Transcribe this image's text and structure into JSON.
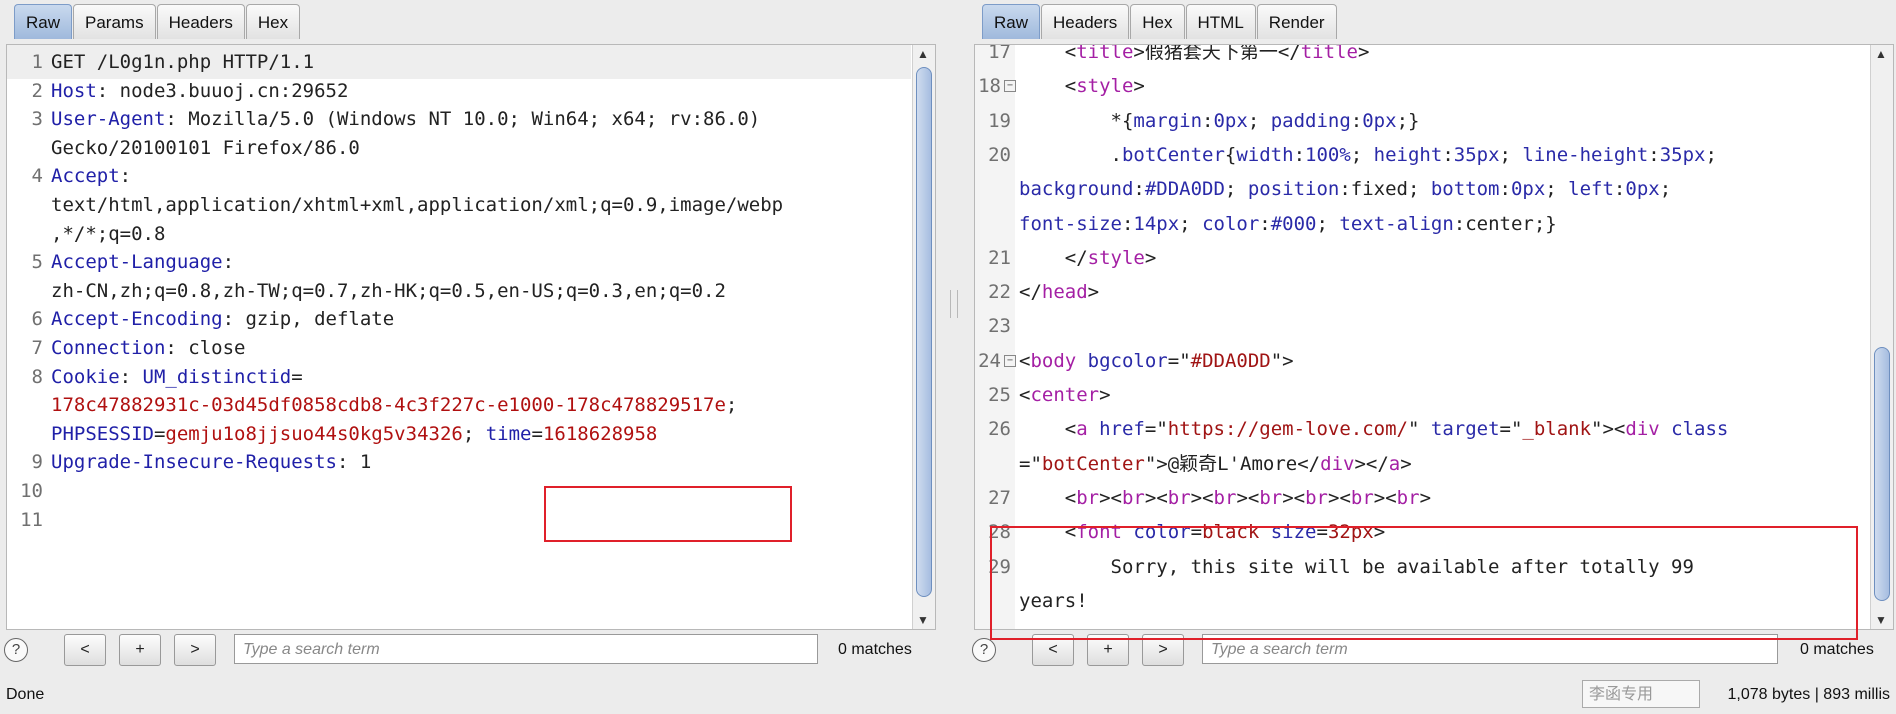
{
  "left": {
    "tabs": [
      "Raw",
      "Params",
      "Headers",
      "Hex"
    ],
    "active_tab": "Raw",
    "search_placeholder": "Type a search term",
    "matches": "0 matches"
  },
  "right": {
    "tabs": [
      "Raw",
      "Headers",
      "Hex",
      "HTML",
      "Render"
    ],
    "active_tab": "Raw",
    "search_placeholder": "Type a search term",
    "matches": "0 matches"
  },
  "nav_labels": {
    "prev": "<",
    "plus": "+",
    "next": ">",
    "help": "?"
  },
  "status": {
    "left": "Done",
    "right": "1,078 bytes | 893 millis",
    "ime": "李函专用"
  },
  "colors": {
    "highlight_box": "#e0202a",
    "active_tab": "#a9c1e2"
  },
  "request_lines": [
    {
      "n": "1",
      "segs": [
        [
          "p",
          "GET /L0g1n.php HTTP/1.1"
        ]
      ]
    },
    {
      "n": "2",
      "segs": [
        [
          "k",
          "Host"
        ],
        [
          "p",
          ": node3.buuoj.cn:29652"
        ]
      ]
    },
    {
      "n": "3",
      "segs": [
        [
          "k",
          "User-Agent"
        ],
        [
          "p",
          ": Mozilla/5.0 (Windows NT 10.0; Win64; x64; rv:86.0)"
        ]
      ]
    },
    {
      "n": "",
      "segs": [
        [
          "p",
          "Gecko/20100101 Firefox/86.0"
        ]
      ]
    },
    {
      "n": "4",
      "segs": [
        [
          "k",
          "Accept"
        ],
        [
          "p",
          ":"
        ]
      ]
    },
    {
      "n": "",
      "segs": [
        [
          "p",
          "text/html,application/xhtml+xml,application/xml;q=0.9,image/webp"
        ]
      ]
    },
    {
      "n": "",
      "segs": [
        [
          "p",
          ",*/*;q=0.8"
        ]
      ]
    },
    {
      "n": "5",
      "segs": [
        [
          "k",
          "Accept-Language"
        ],
        [
          "p",
          ":"
        ]
      ]
    },
    {
      "n": "",
      "segs": [
        [
          "p",
          "zh-CN,zh;q=0.8,zh-TW;q=0.7,zh-HK;q=0.5,en-US;q=0.3,en;q=0.2"
        ]
      ]
    },
    {
      "n": "6",
      "segs": [
        [
          "k",
          "Accept-Encoding"
        ],
        [
          "p",
          ": gzip, deflate"
        ]
      ]
    },
    {
      "n": "7",
      "segs": [
        [
          "k",
          "Connection"
        ],
        [
          "p",
          ": close"
        ]
      ]
    },
    {
      "n": "8",
      "segs": [
        [
          "k",
          "Cookie"
        ],
        [
          "p",
          ": "
        ],
        [
          "k",
          "UM_distinctid"
        ],
        [
          "p",
          "="
        ]
      ]
    },
    {
      "n": "",
      "segs": [
        [
          "v",
          "178c47882931c-03d45df0858cdb8-4c3f227c-e1000-178c478829517e"
        ],
        [
          "p",
          ";"
        ]
      ]
    },
    {
      "n": "",
      "segs": [
        [
          "k",
          "PHPSESSID"
        ],
        [
          "p",
          "="
        ],
        [
          "v",
          "gemju1o8jjsuo44s0kg5v34326"
        ],
        [
          "p",
          "; "
        ],
        [
          "k",
          "time"
        ],
        [
          "p",
          "="
        ],
        [
          "v",
          "1618628958"
        ]
      ]
    },
    {
      "n": "9",
      "segs": [
        [
          "k",
          "Upgrade-Insecure-Requests"
        ],
        [
          "p",
          ": 1"
        ]
      ]
    },
    {
      "n": "10",
      "segs": []
    },
    {
      "n": "11",
      "segs": []
    }
  ],
  "response_lines": [
    {
      "n": "17",
      "fold": false,
      "segs": [
        [
          "p",
          "    <"
        ],
        [
          "t",
          "title"
        ],
        [
          "p",
          ">假猪套天下第一</"
        ],
        [
          "t",
          "title"
        ],
        [
          "p",
          ">"
        ]
      ]
    },
    {
      "n": "18",
      "fold": true,
      "segs": [
        [
          "p",
          "    <"
        ],
        [
          "t",
          "style"
        ],
        [
          "p",
          ">"
        ]
      ]
    },
    {
      "n": "19",
      "fold": false,
      "segs": [
        [
          "p",
          "        *{"
        ],
        [
          "a",
          "margin"
        ],
        [
          "p",
          ":"
        ],
        [
          "a",
          "0px"
        ],
        [
          "p",
          "; "
        ],
        [
          "a",
          "padding"
        ],
        [
          "p",
          ":"
        ],
        [
          "a",
          "0px"
        ],
        [
          "p",
          ";}"
        ]
      ]
    },
    {
      "n": "20",
      "fold": false,
      "segs": [
        [
          "p",
          "        ."
        ],
        [
          "a",
          "botCenter"
        ],
        [
          "p",
          "{"
        ],
        [
          "a",
          "width"
        ],
        [
          "p",
          ":"
        ],
        [
          "a",
          "100%"
        ],
        [
          "p",
          "; "
        ],
        [
          "a",
          "height"
        ],
        [
          "p",
          ":"
        ],
        [
          "a",
          "35px"
        ],
        [
          "p",
          "; "
        ],
        [
          "a",
          "line-height"
        ],
        [
          "p",
          ":"
        ],
        [
          "a",
          "35px"
        ],
        [
          "p",
          ";"
        ]
      ]
    },
    {
      "n": "",
      "fold": false,
      "segs": [
        [
          "a",
          "background"
        ],
        [
          "p",
          ":"
        ],
        [
          "a",
          "#DDA0DD"
        ],
        [
          "p",
          "; "
        ],
        [
          "a",
          "position"
        ],
        [
          "p",
          ":fixed; "
        ],
        [
          "a",
          "bottom"
        ],
        [
          "p",
          ":"
        ],
        [
          "a",
          "0px"
        ],
        [
          "p",
          "; "
        ],
        [
          "a",
          "left"
        ],
        [
          "p",
          ":"
        ],
        [
          "a",
          "0px"
        ],
        [
          "p",
          ";"
        ]
      ]
    },
    {
      "n": "",
      "fold": false,
      "segs": [
        [
          "a",
          "font-size"
        ],
        [
          "p",
          ":"
        ],
        [
          "a",
          "14px"
        ],
        [
          "p",
          "; "
        ],
        [
          "a",
          "color"
        ],
        [
          "p",
          ":"
        ],
        [
          "a",
          "#000"
        ],
        [
          "p",
          "; "
        ],
        [
          "a",
          "text-align"
        ],
        [
          "p",
          ":center;}"
        ]
      ]
    },
    {
      "n": "21",
      "fold": false,
      "segs": [
        [
          "p",
          "    </"
        ],
        [
          "t",
          "style"
        ],
        [
          "p",
          ">"
        ]
      ]
    },
    {
      "n": "22",
      "fold": false,
      "segs": [
        [
          "p",
          "</"
        ],
        [
          "t",
          "head"
        ],
        [
          "p",
          ">"
        ]
      ]
    },
    {
      "n": "23",
      "fold": false,
      "segs": []
    },
    {
      "n": "24",
      "fold": true,
      "segs": [
        [
          "p",
          "<"
        ],
        [
          "t",
          "body"
        ],
        [
          "p",
          " "
        ],
        [
          "a",
          "bgcolor"
        ],
        [
          "p",
          "=\""
        ],
        [
          "s",
          "#DDA0DD"
        ],
        [
          "p",
          "\">"
        ]
      ]
    },
    {
      "n": "25",
      "fold": false,
      "segs": [
        [
          "p",
          "<"
        ],
        [
          "t",
          "center"
        ],
        [
          "p",
          ">"
        ]
      ]
    },
    {
      "n": "26",
      "fold": false,
      "segs": [
        [
          "p",
          "    <"
        ],
        [
          "t",
          "a"
        ],
        [
          "p",
          " "
        ],
        [
          "a",
          "href"
        ],
        [
          "p",
          "=\""
        ],
        [
          "s",
          "https://gem-love.com/"
        ],
        [
          "p",
          "\" "
        ],
        [
          "a",
          "target"
        ],
        [
          "p",
          "=\""
        ],
        [
          "s",
          "_blank"
        ],
        [
          "p",
          "\"><"
        ],
        [
          "t",
          "div"
        ],
        [
          "p",
          " "
        ],
        [
          "a",
          "class"
        ]
      ]
    },
    {
      "n": "",
      "fold": false,
      "segs": [
        [
          "p",
          "=\""
        ],
        [
          "s",
          "botCenter"
        ],
        [
          "p",
          "\">@颖奇L'Amore</"
        ],
        [
          "t",
          "div"
        ],
        [
          "p",
          "></"
        ],
        [
          "t",
          "a"
        ],
        [
          "p",
          ">"
        ]
      ]
    },
    {
      "n": "27",
      "fold": false,
      "segs": [
        [
          "p",
          "    <"
        ],
        [
          "t",
          "br"
        ],
        [
          "p",
          "><"
        ],
        [
          "t",
          "br"
        ],
        [
          "p",
          "><"
        ],
        [
          "t",
          "br"
        ],
        [
          "p",
          "><"
        ],
        [
          "t",
          "br"
        ],
        [
          "p",
          "><"
        ],
        [
          "t",
          "br"
        ],
        [
          "p",
          "><"
        ],
        [
          "t",
          "br"
        ],
        [
          "p",
          "><"
        ],
        [
          "t",
          "br"
        ],
        [
          "p",
          "><"
        ],
        [
          "t",
          "br"
        ],
        [
          "p",
          ">"
        ]
      ]
    },
    {
      "n": "28",
      "fold": false,
      "segs": [
        [
          "p",
          "    <"
        ],
        [
          "t",
          "font"
        ],
        [
          "p",
          " "
        ],
        [
          "a",
          "color"
        ],
        [
          "p",
          "="
        ],
        [
          "s",
          "black"
        ],
        [
          "p",
          " "
        ],
        [
          "a",
          "size"
        ],
        [
          "p",
          "="
        ],
        [
          "s",
          "32px"
        ],
        [
          "p",
          ">"
        ]
      ]
    },
    {
      "n": "29",
      "fold": false,
      "segs": [
        [
          "p",
          "        Sorry, this site will be available after totally 99"
        ]
      ]
    },
    {
      "n": "",
      "fold": false,
      "segs": [
        [
          "p",
          "years!"
        ]
      ]
    }
  ]
}
